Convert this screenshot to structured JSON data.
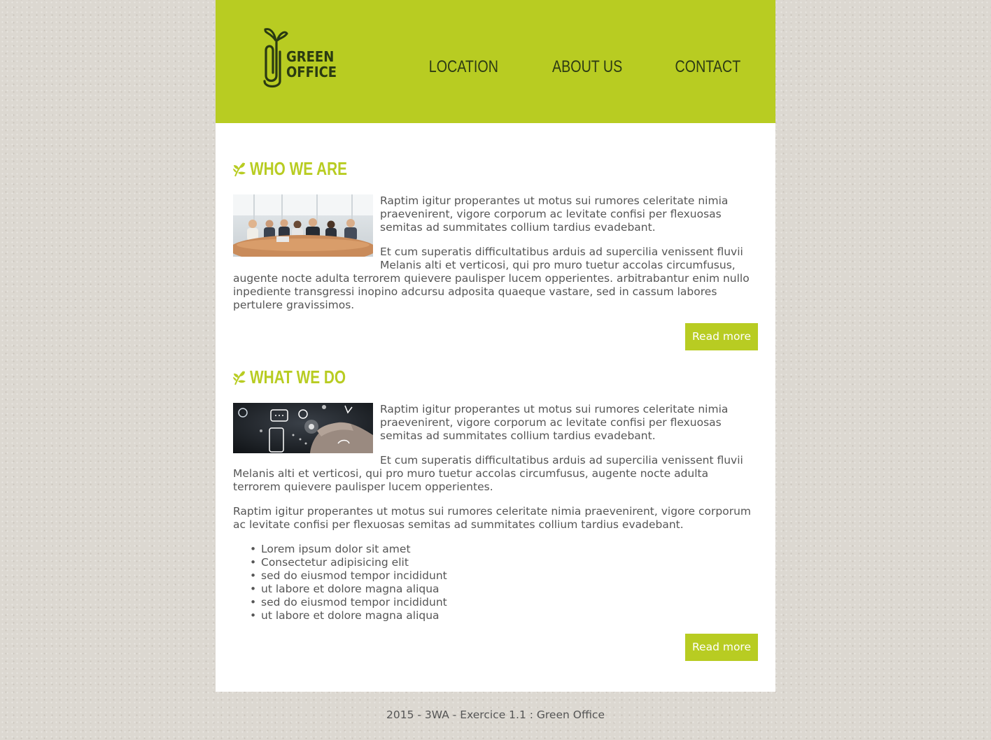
{
  "header": {
    "logo_line1": "GREEN",
    "logo_line2": "OFFICE",
    "nav": [
      "LOCATION",
      "ABOUT US",
      "CONTACT"
    ]
  },
  "sections": [
    {
      "title": "WHO WE ARE",
      "image": "business-team-photo",
      "paragraphs": [
        "Raptim igitur properantes ut motus sui rumores celeritate nimia praevenirent, vigore corporum ac levitate confisi per flexuosas semitas ad summitates collium tardius evadebant.",
        "Et cum superatis difficultatibus arduis ad supercilia venissent fluvii Melanis alti et verticosi, qui pro muro tuetur accolas circumfusus, augente nocte adulta terrorem quievere paulisper lucem opperientes. arbitrabantur enim nullo inpediente transgressi inopino adcursu adposita quaeque vastare, sed in cassum labores pertulere gravissimos."
      ],
      "button": "Read more"
    },
    {
      "title": "WHAT WE DO",
      "image": "touchscreen-icons-photo",
      "paragraphs": [
        "Raptim igitur properantes ut motus sui rumores celeritate nimia praevenirent, vigore corporum ac levitate confisi per flexuosas semitas ad summitates collium tardius evadebant.",
        "Et cum superatis difficultatibus arduis ad supercilia venissent fluvii Melanis alti et verticosi, qui pro muro tuetur accolas circumfusus, augente nocte adulta terrorem quievere paulisper lucem opperientes.",
        "Raptim igitur properantes ut motus sui rumores celeritate nimia praevenirent, vigore corporum ac levitate confisi per flexuosas semitas ad summitates collium tardius evadebant."
      ],
      "bullets": [
        "Lorem ipsum dolor sit amet",
        "Consectetur adipisicing elit",
        "sed do eiusmod tempor incididunt",
        "ut labore et dolore magna aliqua",
        "sed do eiusmod tempor incididunt",
        "ut labore et dolore magna aliqua"
      ],
      "button": "Read more"
    }
  ],
  "footer": "2015 - 3WA - Exercice 1.1 : Green Office",
  "colors": {
    "accent": "#b8cc22",
    "text": "#555555",
    "background": "#dcd8d1"
  }
}
